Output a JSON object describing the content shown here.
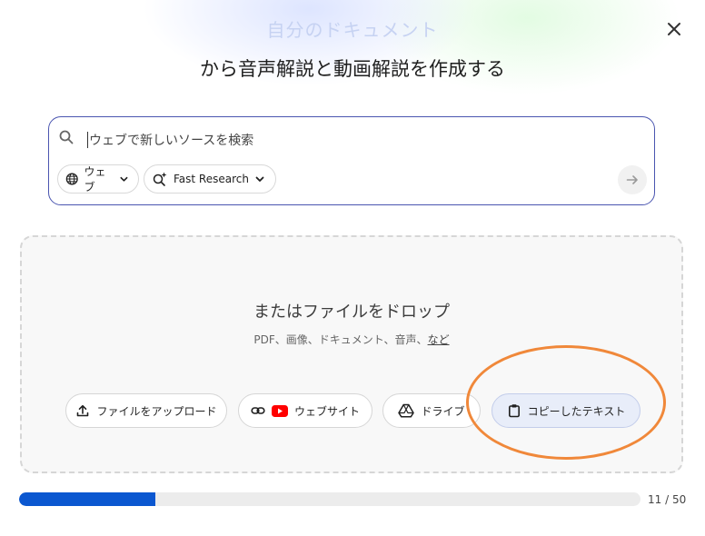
{
  "header": {
    "faded_title": "自分のドキュメント",
    "title": "から音声解説と動画解説を作成する"
  },
  "search": {
    "placeholder": "ウェブで新しいソースを検索",
    "source_chip": "ウェブ",
    "mode_chip": "Fast Research"
  },
  "drop_zone": {
    "title": "またはファイルをドロップ",
    "subtitle": "PDF、画像、ドキュメント、音声、",
    "more_link": "など"
  },
  "sources": {
    "upload": "ファイルをアップロード",
    "website": "ウェブサイト",
    "drive": "ドライブ",
    "paste": "コピーしたテキスト"
  },
  "progress": {
    "current": 11,
    "max": 50,
    "label": "11 / 50"
  },
  "colors": {
    "accent": "#0b57d0",
    "highlight": "#f0883a",
    "youtube": "#ff0000"
  },
  "icons": [
    "close-icon",
    "search-icon",
    "globe-icon",
    "chevron-down-icon",
    "sparkle-search-icon",
    "arrow-right-icon",
    "upload-icon",
    "link-icon",
    "youtube-icon",
    "drive-icon",
    "clipboard-icon"
  ]
}
